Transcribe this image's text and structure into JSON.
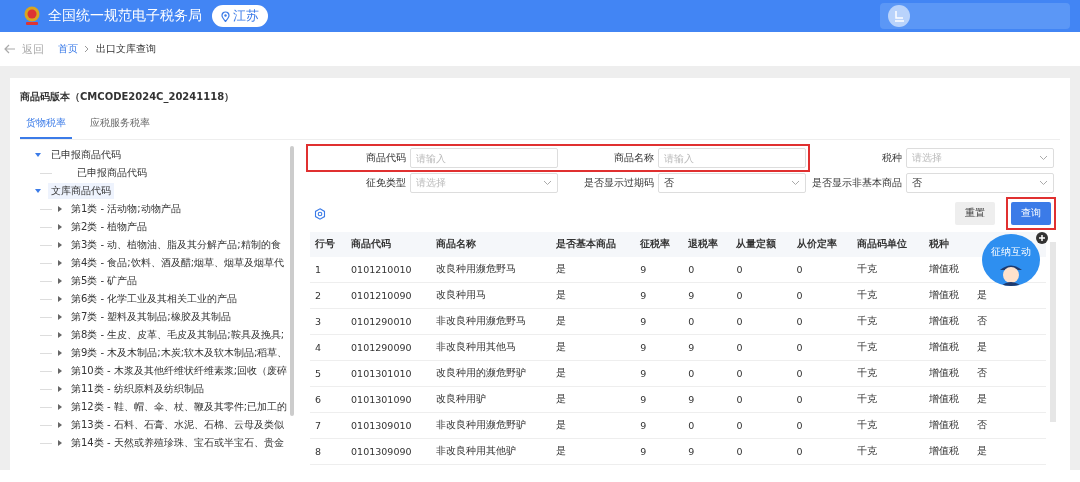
{
  "header": {
    "title": "全国统一规范电子税务局",
    "region": "江苏"
  },
  "breadcrumb": {
    "back": "返回",
    "items": [
      {
        "label": "首页",
        "kind": "link"
      },
      {
        "label": "出口文库查询",
        "kind": "current"
      }
    ]
  },
  "card": {
    "title": "商品码版本（CMCODE2024C_20241118）"
  },
  "tabs": [
    {
      "label": "货物税率",
      "selected": true
    },
    {
      "label": "应税服务税率",
      "selected": false
    }
  ],
  "tree": [
    {
      "label": "已申报商品代码",
      "expanded": true,
      "selected": false,
      "children": [
        {
          "label": "已申报商品代码",
          "selected": false
        }
      ]
    },
    {
      "label": "文库商品代码",
      "expanded": true,
      "selected": true,
      "children": [
        {
          "label": "第1类 - 活动物;动物产品",
          "expanded": false,
          "selected": false
        },
        {
          "label": "第2类 - 植物产品",
          "expanded": false,
          "selected": false
        },
        {
          "label": "第3类 - 动、植物油、脂及其分解产品;精制的食",
          "expanded": false,
          "selected": false
        },
        {
          "label": "第4类 - 食品;饮料、酒及醋;烟草、烟草及烟草代",
          "expanded": false,
          "selected": false
        },
        {
          "label": "第5类 - 矿产品",
          "expanded": false,
          "selected": false
        },
        {
          "label": "第6类 - 化学工业及其相关工业的产品",
          "expanded": false,
          "selected": false
        },
        {
          "label": "第7类 - 塑料及其制品;橡胶及其制品",
          "expanded": false,
          "selected": false
        },
        {
          "label": "第8类 - 生皮、皮革、毛皮及其制品;鞍具及挽具;",
          "expanded": false,
          "selected": false
        },
        {
          "label": "第9类 - 木及木制品;木炭;软木及软木制品;稻草、",
          "expanded": false,
          "selected": false
        },
        {
          "label": "第10类 - 木浆及其他纤维状纤维素浆;回收（废碎",
          "expanded": false,
          "selected": false
        },
        {
          "label": "第11类 - 纺织原料及纺织制品",
          "expanded": false,
          "selected": false
        },
        {
          "label": "第12类 - 鞋、帽、伞、杖、鞭及其零件;已加工的",
          "expanded": false,
          "selected": false
        },
        {
          "label": "第13类 - 石料、石膏、水泥、石棉、云母及类似",
          "expanded": false,
          "selected": false
        },
        {
          "label": "第14类 - 天然或养殖珍珠、宝石或半宝石、贵金",
          "expanded": false,
          "selected": false
        }
      ]
    }
  ],
  "form": {
    "rows": [
      {
        "groups": [
          {
            "highlighted": true,
            "fields": [
              {
                "label": "商品代码",
                "kind": "input",
                "placeholder": "请输入"
              },
              {
                "label": "商品名称",
                "kind": "input",
                "placeholder": "请输入"
              }
            ]
          },
          {
            "highlighted": false,
            "fields": [
              {
                "label": "税种",
                "kind": "select",
                "placeholder": "请选择"
              }
            ]
          }
        ]
      },
      {
        "groups": [
          {
            "highlighted": false,
            "fields": [
              {
                "label": "征免类型",
                "kind": "select",
                "placeholder": "请选择"
              },
              {
                "label": "是否显示过期码",
                "kind": "select",
                "value": "否"
              },
              {
                "label": "是否显示非基本商品",
                "kind": "select",
                "value": "否"
              }
            ]
          }
        ]
      }
    ]
  },
  "buttons": [
    {
      "label": "重置",
      "kind": "secondary",
      "highlighted": false
    },
    {
      "label": "查询",
      "kind": "primary",
      "highlighted": true
    }
  ],
  "table": {
    "columns": [
      "行号",
      "商品代码",
      "商品名称",
      "是否基本商品",
      "征税率",
      "退税率",
      "从量定额",
      "从价定率",
      "商品码单位",
      "税种"
    ],
    "rows": [
      [
        "1",
        "0101210010",
        "改良种用濒危野马",
        "是",
        "9",
        "0",
        "0",
        "0",
        "千克",
        "增值税"
      ],
      [
        "2",
        "0101210090",
        "改良种用马",
        "是",
        "9",
        "9",
        "0",
        "0",
        "千克",
        "增值税",
        "是"
      ],
      [
        "3",
        "0101290010",
        "非改良种用濒危野马",
        "是",
        "9",
        "0",
        "0",
        "0",
        "千克",
        "增值税",
        "否"
      ],
      [
        "4",
        "0101290090",
        "非改良种用其他马",
        "是",
        "9",
        "9",
        "0",
        "0",
        "千克",
        "增值税",
        "是"
      ],
      [
        "5",
        "0101301010",
        "改良种用的濒危野驴",
        "是",
        "9",
        "0",
        "0",
        "0",
        "千克",
        "增值税",
        "否"
      ],
      [
        "6",
        "0101301090",
        "改良种用驴",
        "是",
        "9",
        "9",
        "0",
        "0",
        "千克",
        "增值税",
        "是"
      ],
      [
        "7",
        "0101309010",
        "非改良种用濒危野驴",
        "是",
        "9",
        "0",
        "0",
        "0",
        "千克",
        "增值税",
        "否"
      ],
      [
        "8",
        "0101309090",
        "非改良种用其他驴",
        "是",
        "9",
        "9",
        "0",
        "0",
        "千克",
        "增值税",
        "是"
      ]
    ]
  },
  "assistant_badge": {
    "text": "征纳互动"
  }
}
